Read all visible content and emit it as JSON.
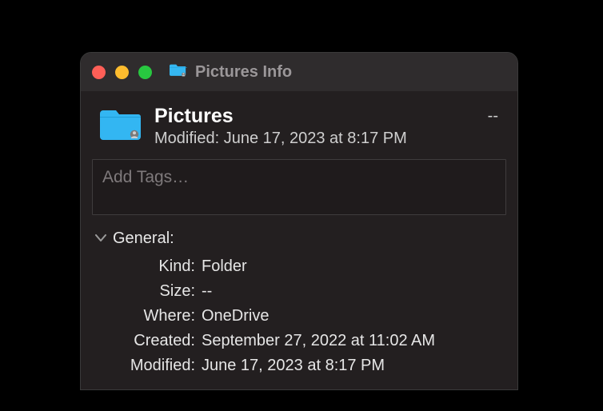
{
  "window": {
    "title": "Pictures Info"
  },
  "summary": {
    "name": "Pictures",
    "modified_label": "Modified:",
    "modified_value": "June 17, 2023 at 8:17 PM",
    "size": "--"
  },
  "tags": {
    "placeholder": "Add Tags…"
  },
  "sections": {
    "general": {
      "title": "General:",
      "rows": {
        "kind": {
          "label": "Kind:",
          "value": "Folder"
        },
        "size": {
          "label": "Size:",
          "value": "--"
        },
        "where": {
          "label": "Where:",
          "value": "OneDrive"
        },
        "created": {
          "label": "Created:",
          "value": "September 27, 2022 at 11:02 AM"
        },
        "modified": {
          "label": "Modified:",
          "value": "June 17, 2023 at 8:17 PM"
        }
      }
    }
  }
}
